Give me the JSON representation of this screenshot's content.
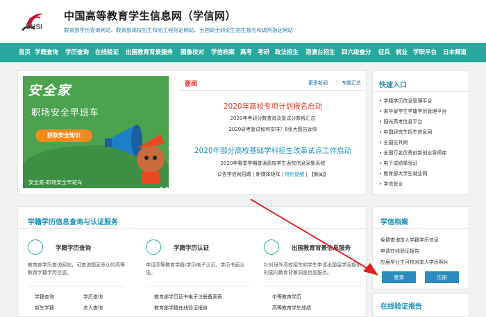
{
  "header": {
    "logo_text": "CHSI",
    "title": "中国高等教育学生信息网（学信网）",
    "subtitle": "教育部学历查询网站、教育部高校招生阳光工程指定网站、全国硕士研究生招生报名和调剂指定网站"
  },
  "nav": [
    "首页",
    "学籍查询",
    "学历查询",
    "在线验证",
    "出国教育背景服务",
    "图像校对",
    "学信档案",
    "高考",
    "考研",
    "政法招生",
    "港澳台招生",
    "四六级查分",
    "征兵",
    "就业",
    "学职平台",
    "日本频道"
  ],
  "banner": {
    "title": "安全家",
    "subtitle": "职场安全早班车",
    "button": "获取安全知识",
    "caption": "安全家-职场安全早班车"
  },
  "news": {
    "heading": "要闻",
    "more": "更多新闻",
    "topics": "专题汇总",
    "headline1": "2020年高校专项计划报名启动",
    "items1": [
      "2020年考研分数查询及复试分数线汇总",
      "2020研考复试如何安排？8张大图告诉你"
    ],
    "headline2": "2020年部分高校基础学科招生改革试点工作启动",
    "items2a": "2020年春季学期普通高校学生返校信息采集系统",
    "items2b_part1": "公告学信网招聘 | 新媒体矩阵 | ",
    "items2b_hl": "特别提醒",
    "items2b_part2": " | 【新闻】"
  },
  "quick": {
    "heading": "快速入口",
    "items": [
      "学籍学历信息管理平台",
      "来华留学生学籍学历管理平台",
      "阳光高考信息平台",
      "中国研究生招生信息网",
      "全国征兵网",
      "全国万名优秀创新创业导师库",
      "电子成绩单验证",
      "教育部大学生就业网",
      "学信就业"
    ]
  },
  "services": {
    "heading": "学籍学历信息查询与认证服务",
    "cards": [
      {
        "title": "学籍学历查询",
        "desc": "教育部学历查询网站，可查询国家承认的高等教育学籍学历信息。",
        "links": [
          "学籍查询",
          "学历查询",
          "新生学籍",
          "本人查询"
        ]
      },
      {
        "title": "学籍学历认证",
        "desc": "申请高等教育学籍/学历电子认证、学历书面认证。",
        "links": [
          "教育部学历证书电子注册备案表",
          "教育部学籍在线验证报告"
        ]
      },
      {
        "title": "出国教育背景信息服务",
        "desc": "针对境外高校招生和学生申请出国留学而提供的国内教育背景调查信息服务。",
        "links": [
          "中等教育学历",
          "高等教育学生成绩"
        ]
      }
    ]
  },
  "archive": {
    "heading": "学信档案",
    "lines": [
      "免费查询本人学籍学历信息",
      "申请在线验证报告",
      "应届毕业生可校对本人学历照片"
    ],
    "login": "登录",
    "register": "注册"
  },
  "verify": {
    "heading": "在线验证报告"
  }
}
